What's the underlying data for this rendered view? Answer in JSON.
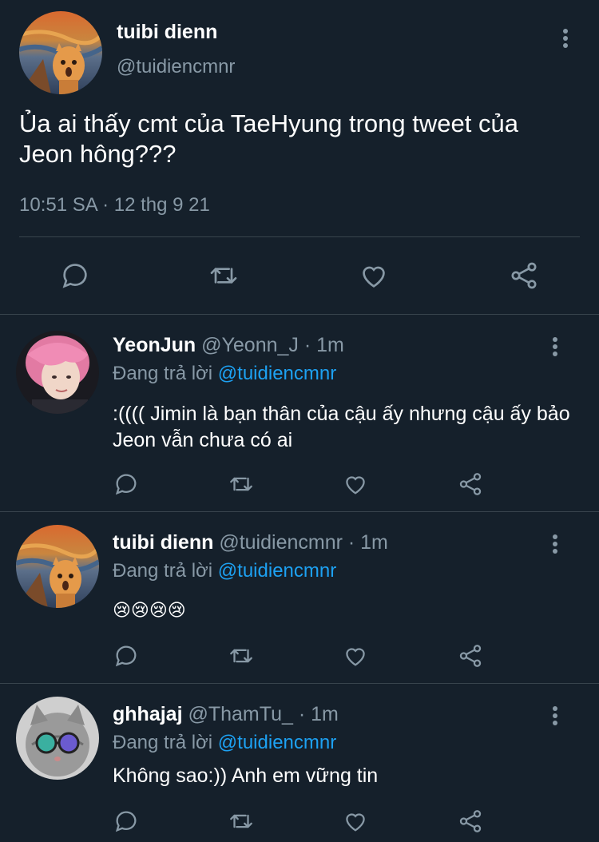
{
  "main_tweet": {
    "name": "tuibi dienn",
    "handle": "@tuidiencmnr",
    "text": "Ủa ai thấy cmt của TaeHyung trong tweet của Jeon hông???",
    "timestamp": "10:51 SA · 12 thg 9 21",
    "actions": [
      "reply-icon",
      "retweet-icon",
      "like-icon",
      "share-icon"
    ]
  },
  "replies": [
    {
      "name": "YeonJun",
      "meta": "@Yeonn_J · 1m",
      "replying_prefix": "Đang trả lời",
      "replying_to": "@tuidiencmnr",
      "text": ":(((( Jimin là bạn thân của cậu ấy nhưng cậu ấy bảo Jeon vẫn chưa có ai"
    },
    {
      "name": "tuibi dienn",
      "meta": "@tuidiencmnr · 1m",
      "replying_prefix": "Đang trả lời",
      "replying_to": "@tuidiencmnr",
      "text": "😢😢😢😢"
    },
    {
      "name": "ghhajaj",
      "meta": "@ThamTu_ · 1m",
      "replying_prefix": "Đang trả lời",
      "replying_to": "@tuidiencmnr",
      "text": "Không sao:)) Anh em vững tin"
    }
  ],
  "colors": {
    "background": "#15202b",
    "border": "#38444d",
    "secondary_text": "#8899a6",
    "accent": "#1da1f2"
  }
}
